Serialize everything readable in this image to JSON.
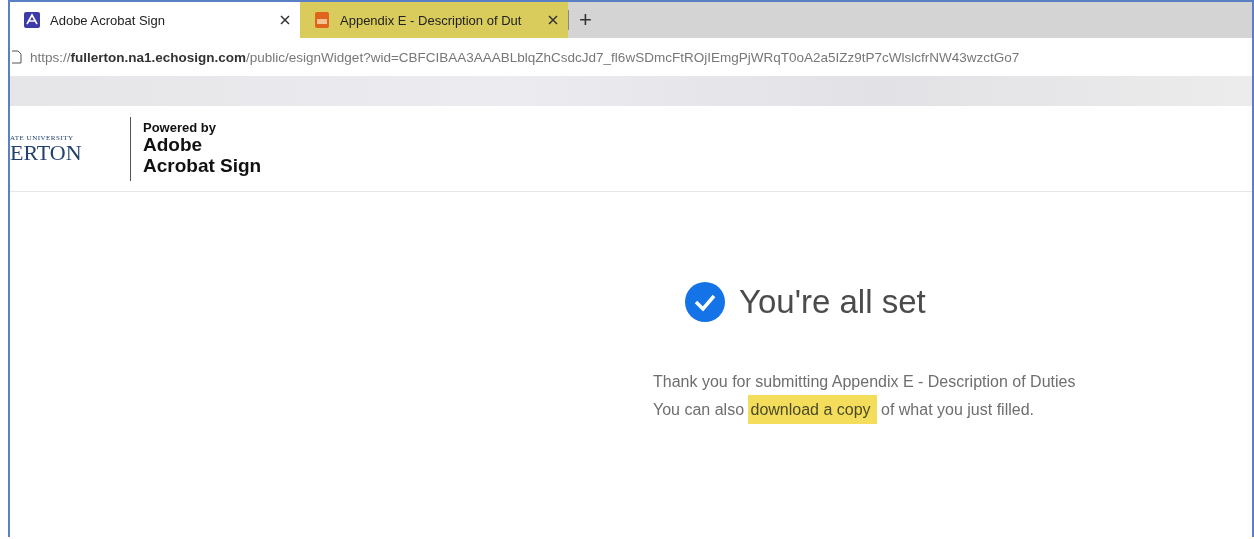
{
  "tabs": [
    {
      "title": "Adobe Acrobat Sign",
      "kind": "acrobat",
      "selected": true,
      "highlighted": false
    },
    {
      "title": "Appendix E - Description of Dut",
      "kind": "pdf",
      "selected": false,
      "highlighted": true
    }
  ],
  "new_tab": "+",
  "address_bar": {
    "scheme": "https://",
    "host": "fullerton.na1.echosign.com",
    "path": "/public/esignWidget?wid=CBFCIBAA3AAABLblqZhCsdcJd7_fl6wSDmcFtROjIEmgPjWRqT0oA2a5IZz9tP7cWlslcfrNW43wzctGo7"
  },
  "header": {
    "logo_small": "ATE UNIVERSITY",
    "logo_large": "ERTON",
    "powered_by": "Powered by",
    "brand_line_1": "Adobe",
    "brand_line_2": "Acrobat Sign"
  },
  "confirmation": {
    "title": "You're all set",
    "message": "Thank you for submitting Appendix E - Description of Duties",
    "download_before": "You can also ",
    "download_link": "download a copy",
    "download_after": " of what you just filled.",
    "link_highlighted": true
  }
}
